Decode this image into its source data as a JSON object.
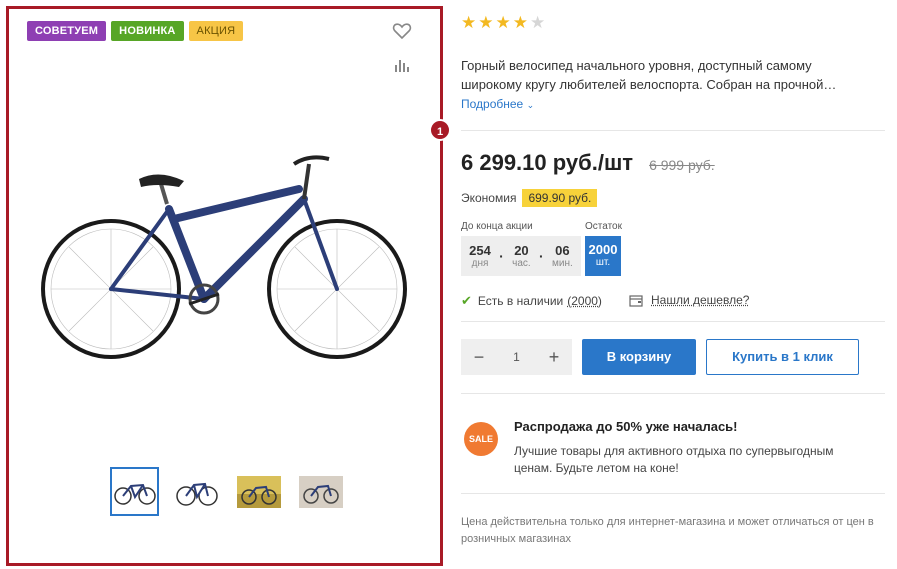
{
  "gallery": {
    "badges": [
      {
        "label": "СОВЕТУЕМ",
        "color": "#8e3fb3"
      },
      {
        "label": "НОВИНКА",
        "color": "#57a626"
      },
      {
        "label": "АКЦИЯ",
        "color": "#f7c546"
      }
    ],
    "favorite_icon": "heart-icon",
    "compare_icon": "bar-chart-icon",
    "thumbnails_count": 4,
    "active_thumbnail": 1,
    "marker": "1",
    "frame_color": "#a81a26"
  },
  "product": {
    "rating": 4,
    "rating_max": 5,
    "description": "Горный велосипед начального уровня, доступный самому широкому кругу любителей велоспорта. Собран на прочной…",
    "more_link": "Подробнее",
    "price": "6 299.10 руб./шт",
    "old_price": "6 999 руб.",
    "economy_label": "Экономия",
    "economy_value": "699.90 руб.",
    "timer": {
      "label": "До конца акции",
      "days": "254",
      "days_unit": "дня",
      "hours": "20",
      "hours_unit": "час.",
      "minutes": "06",
      "minutes_unit": "мин."
    },
    "stock": {
      "label": "Остаток",
      "value": "2000",
      "unit": "шт."
    },
    "availability": {
      "label": "Есть в наличии",
      "count": "(2000)"
    },
    "cheaper_link": "Нашли дешевле?",
    "quantity": "1",
    "cart_button": "В корзину",
    "oneclick_button": "Купить в 1 клик",
    "promo": {
      "badge": "SALE",
      "title": "Распродажа до 50% уже началась!",
      "text": "Лучшие товары для активного отдыха по супервыгодным ценам. Будьте летом на коне!"
    },
    "note": "Цена действительна только для интернет-магазина и может отличаться от цен в розничных магазинах",
    "accent_color": "#2a77c9"
  }
}
